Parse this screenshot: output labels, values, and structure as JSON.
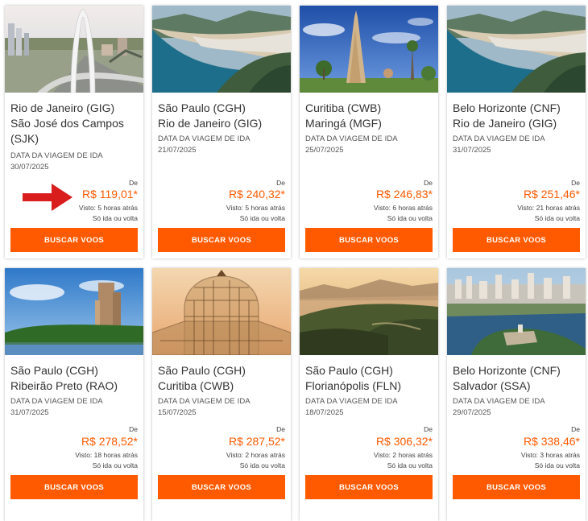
{
  "accent_color": "#ff5a00",
  "date_label": "DATA DA VIAGEM DE IDA",
  "from_label": "De",
  "trip_note": "Só ida ou volta",
  "button_label": "BUSCAR VOOS",
  "cards": [
    {
      "origin": "Rio de Janeiro (GIG)",
      "destination": "São José dos Campos (SJK)",
      "date": "30/07/2025",
      "price": "R$ 119,01*",
      "seen": "Visto: 5 horas atrás",
      "image": "sjk-arch-photo"
    },
    {
      "origin": "São Paulo (CGH)",
      "destination": "Rio de Janeiro (GIG)",
      "date": "21/07/2025",
      "price": "R$ 240,32*",
      "seen": "Visto: 5 horas atrás",
      "image": "rio-beach-photo"
    },
    {
      "origin": "Curitiba (CWB)",
      "destination": "Maringá (MGF)",
      "date": "25/07/2025",
      "price": "R$ 246,83*",
      "seen": "Visto: 6 horas atrás",
      "image": "maringa-cathedral-photo"
    },
    {
      "origin": "Belo Horizonte (CNF)",
      "destination": "Rio de Janeiro (GIG)",
      "date": "31/07/2025",
      "price": "R$ 251,46*",
      "seen": "Visto: 21 horas atrás",
      "image": "rio-beach-photo"
    },
    {
      "origin": "São Paulo (CGH)",
      "destination": "Ribeirão Preto (RAO)",
      "date": "31/07/2025",
      "price": "R$ 278,52*",
      "seen": "Visto: 18 horas atrás",
      "image": "ribeirao-lake-photo"
    },
    {
      "origin": "São Paulo (CGH)",
      "destination": "Curitiba (CWB)",
      "date": "15/07/2025",
      "price": "R$ 287,52*",
      "seen": "Visto: 2 horas atrás",
      "image": "curitiba-greenhouse-photo"
    },
    {
      "origin": "São Paulo (CGH)",
      "destination": "Florianópolis (FLN)",
      "date": "18/07/2025",
      "price": "R$ 306,32*",
      "seen": "Visto: 2 horas atrás",
      "image": "floripa-sunset-photo"
    },
    {
      "origin": "Belo Horizonte (CNF)",
      "destination": "Salvador (SSA)",
      "date": "29/07/2025",
      "price": "R$ 338,46*",
      "seen": "Visto: 3 horas atrás",
      "image": "salvador-coast-photo"
    }
  ]
}
